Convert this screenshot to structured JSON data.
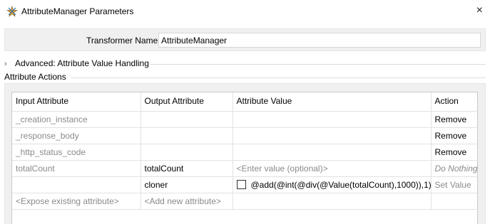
{
  "window": {
    "title": "AttributeManager Parameters",
    "close_glyph": "×",
    "icon": "transformer-icon"
  },
  "transformer": {
    "label": "Transformer Name:",
    "value": "AttributeManager"
  },
  "advanced": {
    "chevron": "›",
    "label": "Advanced: Attribute Value Handling"
  },
  "actions": {
    "title": "Attribute Actions",
    "columns": [
      "Input Attribute",
      "Output Attribute",
      "Attribute Value",
      "Action"
    ],
    "rows": [
      {
        "input": "_creation_instance",
        "output": "",
        "value": "",
        "action": "Remove"
      },
      {
        "input": "_response_body",
        "output": "",
        "value": "",
        "action": "Remove"
      },
      {
        "input": "_http_status_code",
        "output": "",
        "value": "",
        "action": "Remove"
      },
      {
        "input": "totalCount",
        "output": "totalCount",
        "value": "<Enter value (optional)>",
        "action": "Do Nothing"
      },
      {
        "input": "",
        "output": "cloner",
        "value": "@add(@int(@div(@Value(totalCount),1000)),1)",
        "action": "Set Value"
      },
      {
        "input": "<Expose existing attribute>",
        "output": "<Add new attribute>",
        "value": "",
        "action": ""
      }
    ]
  },
  "colors": {
    "panel_bg": "#f0f0f0",
    "muted_text": "#8a8a8a",
    "grid_line": "#e2e2e2"
  }
}
